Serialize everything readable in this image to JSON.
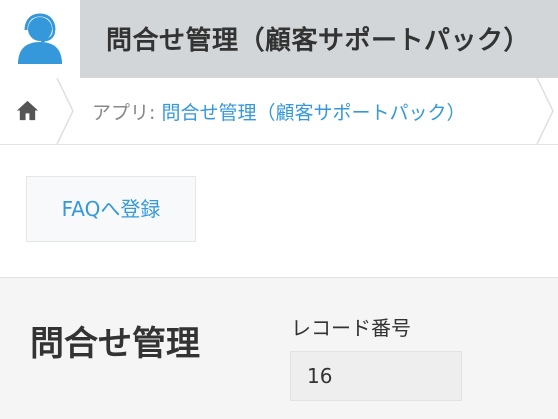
{
  "header": {
    "app_icon": "customer-support-icon",
    "title": "問合せ管理（顧客サポートパック）",
    "accent_color": "#3498db"
  },
  "breadcrumb": {
    "home_icon": "home-icon",
    "prefix": "アプリ: ",
    "app_link": "問合せ管理（顧客サポートパック）"
  },
  "toolbar": {
    "faq_button_label": "FAQへ登録"
  },
  "record": {
    "form_title": "問合せ管理",
    "fields": [
      {
        "label": "レコード番号",
        "value": "16"
      }
    ]
  }
}
